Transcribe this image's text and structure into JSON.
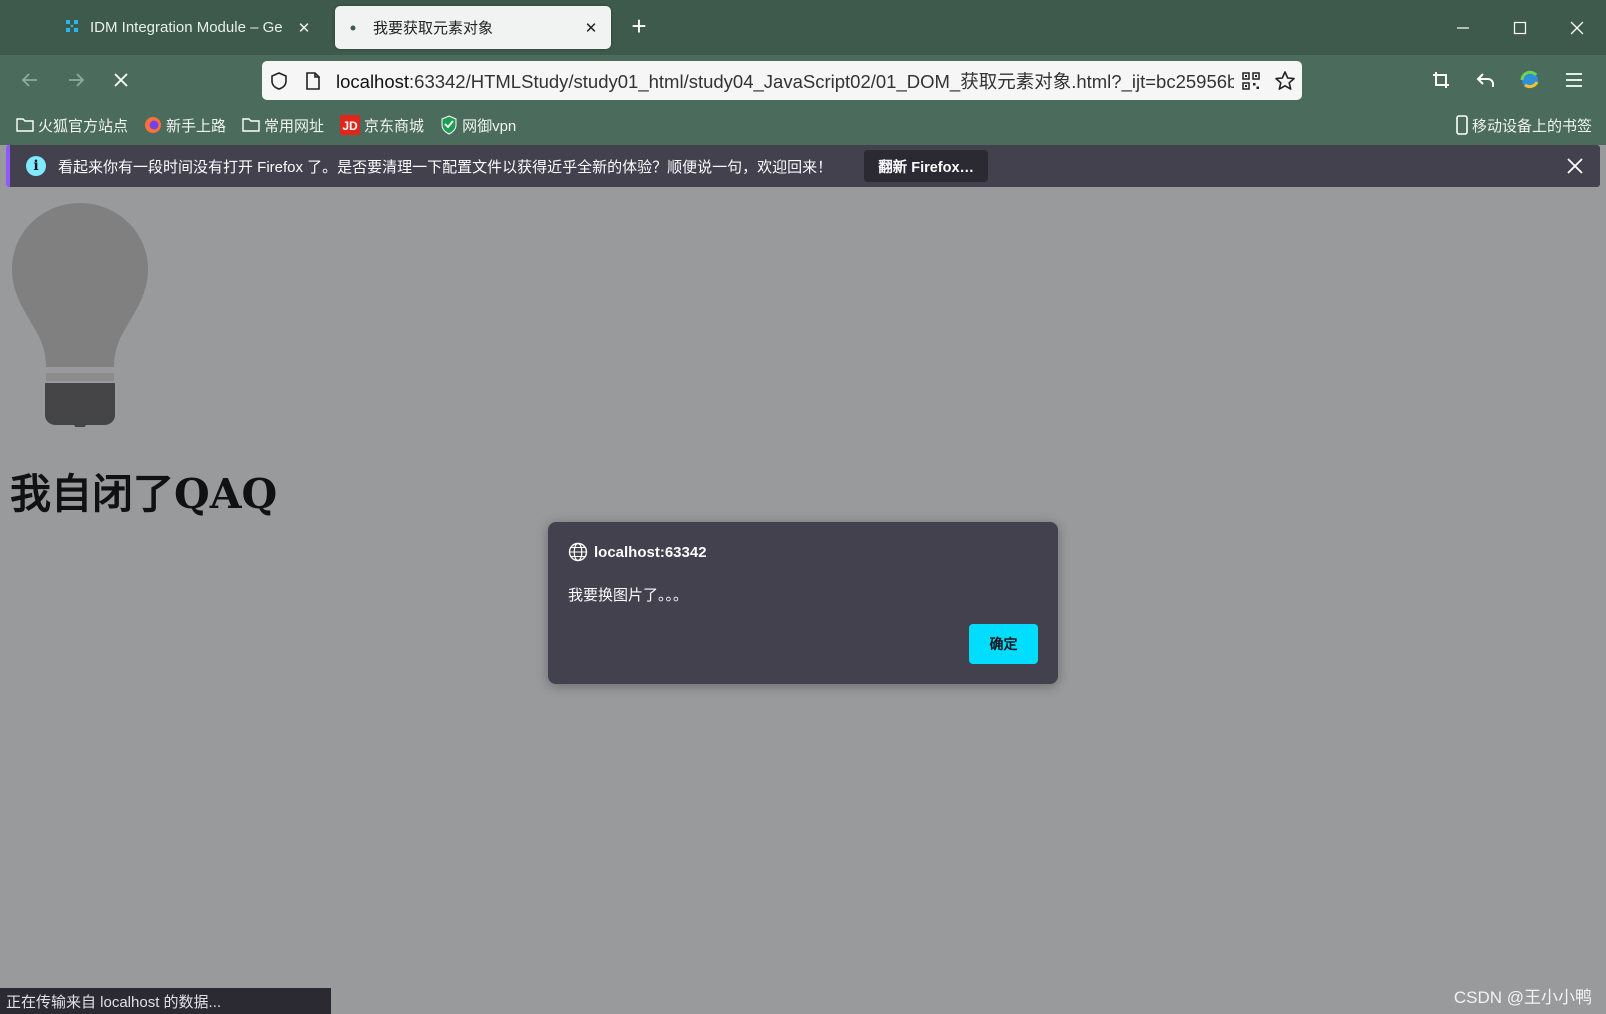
{
  "tabs": [
    {
      "title": "IDM Integration Module – Ge",
      "favicon": "puzzle-icon",
      "active": false
    },
    {
      "title": "我要获取元素对象",
      "favicon": "loading-dot",
      "active": true
    }
  ],
  "toolbar": {
    "url_host": "localhost",
    "url_path": ":63342/HTMLStudy/study01_html/study04_JavaScript02/01_DOM_获取元素对象.html?_ijt=bc25956b"
  },
  "bookmarks": [
    {
      "label": "火狐官方站点",
      "icon": "folder-icon"
    },
    {
      "label": "新手上路",
      "icon": "firefox-icon"
    },
    {
      "label": "常用网址",
      "icon": "folder-icon"
    },
    {
      "label": "京东商城",
      "icon": "jd-icon"
    },
    {
      "label": "网御vpn",
      "icon": "shield-icon"
    }
  ],
  "bookmarks_right": "移动设备上的书签",
  "notification": {
    "message": "看起来你有一段时间没有打开 Firefox 了。是否要清理一下配置文件以获得近乎全新的体验？顺便说一句，欢迎回来！",
    "button": "翻新 Firefox…"
  },
  "page": {
    "heading": "我自闭了QAQ"
  },
  "dialog": {
    "origin": "localhost:63342",
    "message": "我要换图片了。。。",
    "ok": "确定"
  },
  "status": "正在传输来自 localhost 的数据...",
  "watermark": "CSDN @王小小鸭",
  "colors": {
    "titlebar": "#3e5a4d",
    "toolbar": "#4b6b5c",
    "dialog_bg": "#42414d",
    "dialog_button": "#00ddff",
    "page_bg": "#999a9c"
  }
}
